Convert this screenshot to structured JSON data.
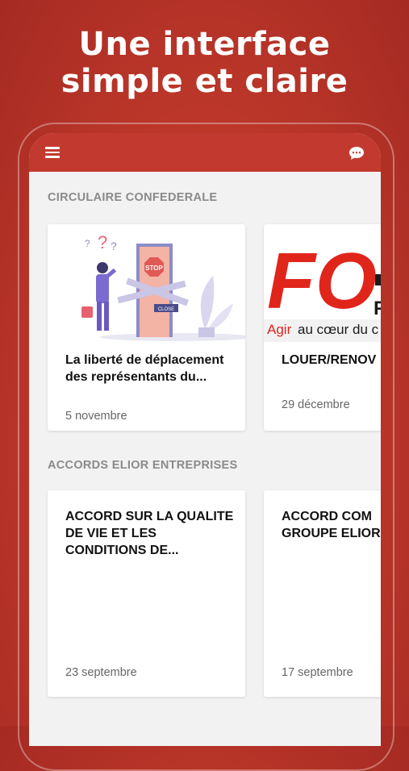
{
  "promo": {
    "headline_line1": "Une interface",
    "headline_line2": "simple et claire"
  },
  "app_bar": {
    "color": "#c23a2f",
    "menu_icon": "hamburger-menu-icon",
    "chat_icon": "chat-bubble-icon"
  },
  "sections": [
    {
      "title": "CIRCULAIRE CONFEDERALE",
      "cards": [
        {
          "title": "La liberté de déplacement des représentants du...",
          "date": "5 novembre",
          "image": "stop-door-illustration"
        },
        {
          "title": "LOUER/RENOV",
          "date": "29 décembre",
          "image": "fo-logo",
          "image_text_main": "FO",
          "image_text_sub_red": "Agir",
          "image_text_sub": "au cœur du c"
        }
      ]
    },
    {
      "title": "ACCORDS ELIOR ENTREPRISES",
      "cards": [
        {
          "title": "ACCORD SUR LA QUALITE DE VIE ET LES CONDITIONS DE...",
          "date": "23 septembre"
        },
        {
          "title": "ACCORD COM GROUPE ELIOR",
          "date": "17 septembre"
        }
      ]
    }
  ]
}
